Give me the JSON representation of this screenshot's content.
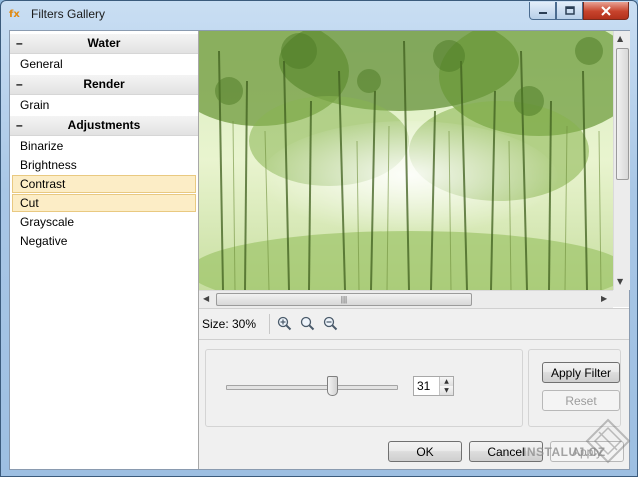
{
  "window": {
    "title": "Filters Gallery",
    "app_icon": "filters-app-icon"
  },
  "filters": {
    "groups": [
      {
        "label": "Water",
        "toggle": "–",
        "items": [
          {
            "label": "General",
            "selected": false
          }
        ]
      },
      {
        "label": "Render",
        "toggle": "–",
        "items": [
          {
            "label": "Grain",
            "selected": false
          }
        ]
      },
      {
        "label": "Adjustments",
        "toggle": "–",
        "items": [
          {
            "label": "Binarize",
            "selected": false
          },
          {
            "label": "Brightness",
            "selected": false
          },
          {
            "label": "Contrast",
            "selected": true
          },
          {
            "label": "Cut",
            "selected": true
          },
          {
            "label": "Grayscale",
            "selected": false
          },
          {
            "label": "Negative",
            "selected": false
          }
        ]
      }
    ]
  },
  "preview": {
    "size_label": "Size: 30%",
    "image_description_icon": "forest-photo"
  },
  "params": {
    "value": "31",
    "slider_fraction": 0.62
  },
  "actions": {
    "apply_filter": "Apply Filter",
    "reset": "Reset"
  },
  "footer": {
    "ok": "OK",
    "cancel": "Cancel",
    "apply": "Apply"
  },
  "watermark": {
    "text": "INSTALUJ.CZ"
  },
  "colors": {
    "selection_bg": "#fcedc6",
    "selection_border": "#e9c981",
    "close_button": "#c7432c"
  }
}
